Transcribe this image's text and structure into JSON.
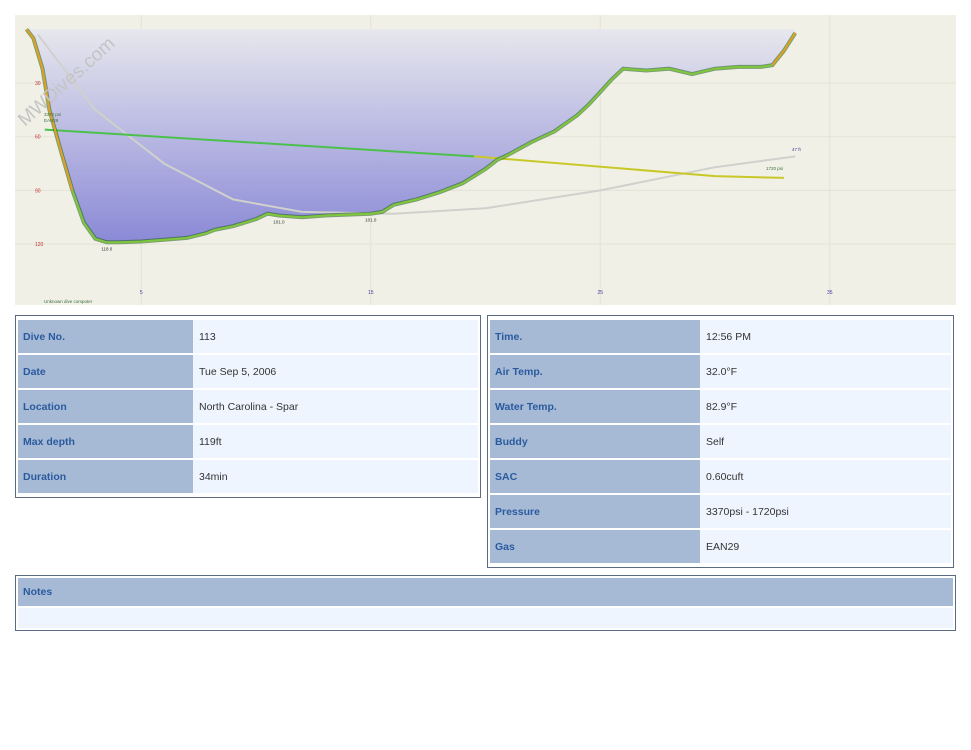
{
  "profile": {
    "watermark": "MWDives.com",
    "start_pressure_label": "3370 psi",
    "start_gas_label": "EAN29",
    "end_pressure_label": "1720 psi",
    "temp_label": "47 ft",
    "computer_label": "Unknown dive computer",
    "colors": {
      "background": "#f1f0e6",
      "fill_top": "#e7e7ee",
      "fill_bottom": "#8a89d6",
      "depth_line": "#7ec83a",
      "depth_line_dark": "#1f5a1a",
      "depth_line_fast": "#e0a020",
      "pressure_green": "#4cc04c",
      "pressure_yellow": "#c8c828",
      "ceiling_curve": "#d0d0cc"
    },
    "chart_data": {
      "type": "area",
      "xlabel": "",
      "ylabel": "",
      "x_ticks": [
        5,
        15,
        25,
        35
      ],
      "y_ticks": [
        30,
        60,
        90,
        120
      ],
      "xlim": [
        -0.5,
        40.5
      ],
      "ylim": [
        -8,
        154
      ],
      "depth_points": [
        [
          0,
          0
        ],
        [
          0.3,
          5
        ],
        [
          0.7,
          22
        ],
        [
          1,
          45
        ],
        [
          1.5,
          68
        ],
        [
          2,
          90
        ],
        [
          2.5,
          108
        ],
        [
          3,
          117
        ],
        [
          3.5,
          119
        ],
        [
          4,
          119
        ],
        [
          5,
          118.5
        ],
        [
          6,
          117.5
        ],
        [
          7,
          116.5
        ],
        [
          7.8,
          114
        ],
        [
          8.2,
          112
        ],
        [
          9,
          110
        ],
        [
          10,
          106
        ],
        [
          10.5,
          103
        ],
        [
          11,
          104
        ],
        [
          12,
          105
        ],
        [
          13,
          104
        ],
        [
          14,
          103.5
        ],
        [
          15,
          103
        ],
        [
          15.5,
          102
        ],
        [
          16,
          98
        ],
        [
          17,
          95
        ],
        [
          18,
          91
        ],
        [
          19,
          86
        ],
        [
          20,
          78
        ],
        [
          20.5,
          73
        ],
        [
          21,
          70
        ],
        [
          22,
          63
        ],
        [
          23,
          57
        ],
        [
          24,
          48
        ],
        [
          24.5,
          42
        ],
        [
          25,
          35
        ],
        [
          25.5,
          28
        ],
        [
          26,
          22
        ],
        [
          27,
          23
        ],
        [
          28,
          22
        ],
        [
          29,
          25
        ],
        [
          30,
          22
        ],
        [
          31,
          21
        ],
        [
          32,
          21
        ],
        [
          32.5,
          20
        ],
        [
          33,
          12
        ],
        [
          33.5,
          2
        ]
      ],
      "annotations": [
        {
          "x": 3.5,
          "y": 119,
          "label": "118.0"
        },
        {
          "x": 11,
          "y": 104,
          "label": "101.0"
        },
        {
          "x": 15,
          "y": 103,
          "label": "101.0"
        }
      ],
      "series": [
        {
          "name": "",
          "points": [
            [
              0.8,
              56
            ],
            [
              19.5,
              71
            ],
            [
              30,
              82
            ],
            [
              33,
              83
            ]
          ]
        },
        {
          "name": "",
          "points": [
            [
              0.5,
              3
            ],
            [
              3,
              45
            ],
            [
              6,
              75
            ],
            [
              9,
              95
            ],
            [
              12,
              102
            ],
            [
              16,
              103
            ],
            [
              20,
              100
            ],
            [
              25,
              90
            ],
            [
              30,
              77
            ],
            [
              33.5,
              71
            ]
          ]
        }
      ]
    }
  },
  "left_table": [
    {
      "label": "Dive No.",
      "value": "113"
    },
    {
      "label": "Date",
      "value": "Tue Sep 5, 2006"
    },
    {
      "label": "Location",
      "value": "North Carolina - Spar"
    },
    {
      "label": "Max depth",
      "value": "119ft"
    },
    {
      "label": "Duration",
      "value": "34min"
    }
  ],
  "right_table": [
    {
      "label": "Time.",
      "value": "12:56 PM"
    },
    {
      "label": "Air Temp.",
      "value": "32.0°F"
    },
    {
      "label": "Water Temp.",
      "value": "82.9°F"
    },
    {
      "label": "Buddy",
      "value": "Self"
    },
    {
      "label": "SAC",
      "value": "0.60cuft"
    },
    {
      "label": "Pressure",
      "value": "3370psi - 1720psi"
    },
    {
      "label": "Gas",
      "value": "EAN29"
    }
  ],
  "notes": {
    "label": "Notes",
    "text": ""
  }
}
